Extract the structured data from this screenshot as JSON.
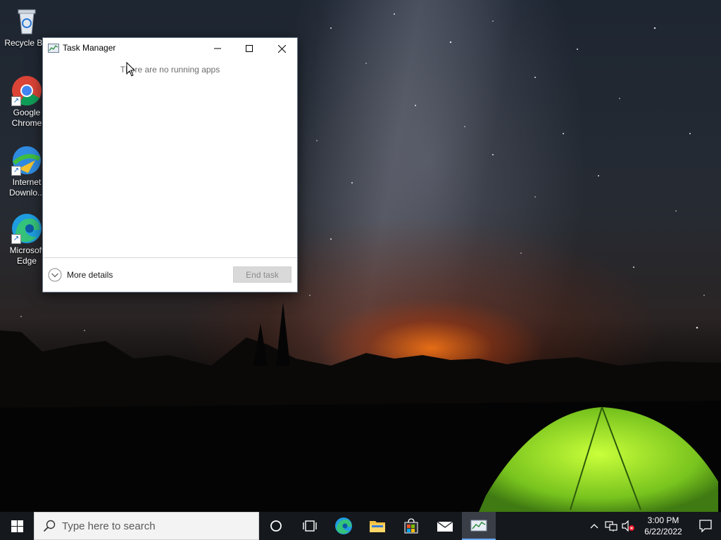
{
  "desktop": {
    "icons": [
      {
        "label": "Recycle Bin",
        "icon": "recycle-bin-icon"
      },
      {
        "label": "Google Chrome",
        "icon": "chrome-icon"
      },
      {
        "label": "Internet Downlo...",
        "icon": "internet-download-manager-icon"
      },
      {
        "label": "Microsoft Edge",
        "icon": "edge-icon"
      }
    ]
  },
  "task_manager": {
    "title": "Task Manager",
    "empty_message": "There are no running apps",
    "more_details_label": "More details",
    "end_task_label": "End task",
    "end_task_enabled": false
  },
  "taskbar": {
    "search_placeholder": "Type here to search",
    "pinned": [
      {
        "name": "cortana",
        "icon": "cortana-icon"
      },
      {
        "name": "task-view",
        "icon": "task-view-icon"
      },
      {
        "name": "edge",
        "icon": "edge-icon"
      },
      {
        "name": "file-explorer",
        "icon": "folder-icon"
      },
      {
        "name": "microsoft-store",
        "icon": "store-icon"
      },
      {
        "name": "mail",
        "icon": "mail-icon"
      },
      {
        "name": "task-manager",
        "icon": "task-manager-icon",
        "active": true
      }
    ],
    "tray": {
      "icons": [
        "chevron-up-icon",
        "network-icon",
        "volume-muted-icon"
      ],
      "time": "3:00 PM",
      "date": "6/22/2022"
    }
  },
  "colors": {
    "taskbar_bg": "#15181d",
    "active_indicator": "#6aa9ff",
    "window_border": "#6b7a8c"
  }
}
